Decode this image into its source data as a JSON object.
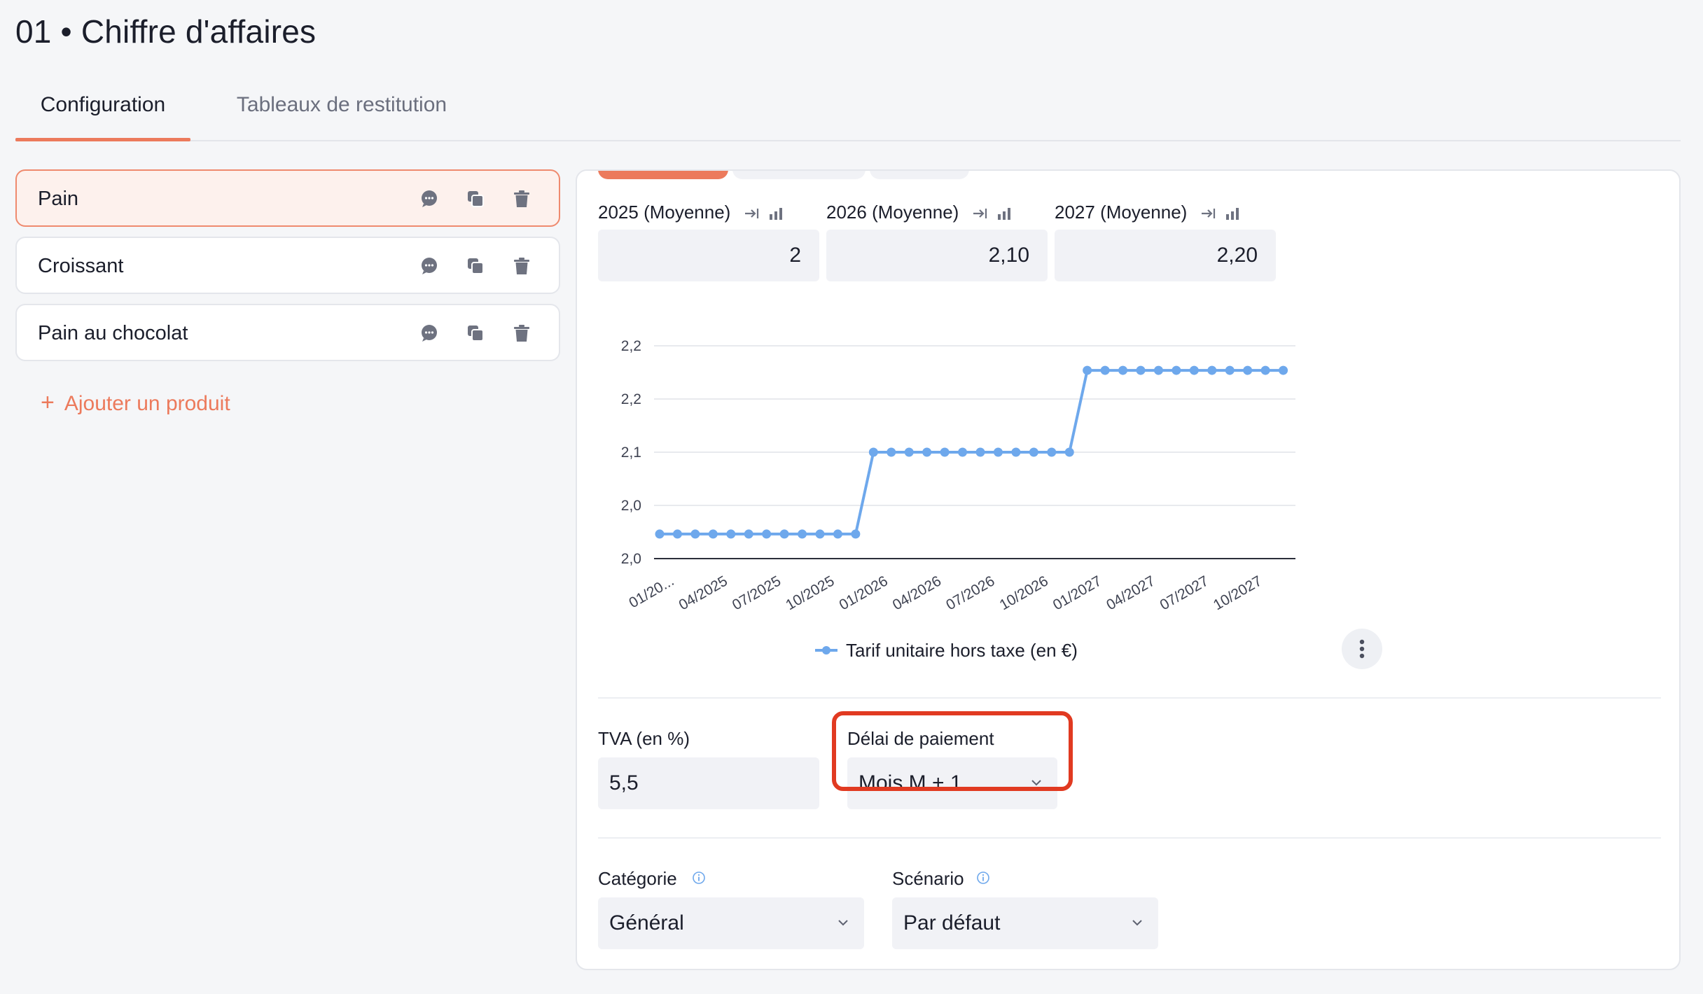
{
  "header": {
    "title": "01 • Chiffre d'affaires"
  },
  "tabs": [
    {
      "label": "Configuration",
      "active": true
    },
    {
      "label": "Tableaux de restitution",
      "active": false
    }
  ],
  "products": [
    {
      "name": "Pain",
      "selected": true
    },
    {
      "name": "Croissant",
      "selected": false
    },
    {
      "name": "Pain au chocolat",
      "selected": false
    }
  ],
  "add_product_label": "Ajouter un produit",
  "years": [
    {
      "label": "2025 (Moyenne)",
      "value": "2"
    },
    {
      "label": "2026 (Moyenne)",
      "value": "2,10"
    },
    {
      "label": "2027 (Moyenne)",
      "value": "2,20"
    }
  ],
  "chart_data": {
    "type": "line",
    "x": [
      "01/2025",
      "02/2025",
      "03/2025",
      "04/2025",
      "05/2025",
      "06/2025",
      "07/2025",
      "08/2025",
      "09/2025",
      "10/2025",
      "11/2025",
      "12/2025",
      "01/2026",
      "02/2026",
      "03/2026",
      "04/2026",
      "05/2026",
      "06/2026",
      "07/2026",
      "08/2026",
      "09/2026",
      "10/2026",
      "11/2026",
      "12/2026",
      "01/2027",
      "02/2027",
      "03/2027",
      "04/2027",
      "05/2027",
      "06/2027",
      "07/2027",
      "08/2027",
      "09/2027",
      "10/2027",
      "11/2027",
      "12/2027"
    ],
    "x_tick_labels": [
      "01/20...",
      "04/2025",
      "07/2025",
      "10/2025",
      "01/2026",
      "04/2026",
      "07/2026",
      "10/2026",
      "01/2027",
      "04/2027",
      "07/2027",
      "10/2027"
    ],
    "y_tick_labels": [
      "2,2",
      "2,2",
      "2,1",
      "2,0",
      "2,0"
    ],
    "ylim": [
      1.97,
      2.23
    ],
    "series": [
      {
        "name": "Tarif unitaire hors taxe (en €)",
        "color": "#6ea8ec",
        "values": [
          2.0,
          2.0,
          2.0,
          2.0,
          2.0,
          2.0,
          2.0,
          2.0,
          2.0,
          2.0,
          2.0,
          2.0,
          2.1,
          2.1,
          2.1,
          2.1,
          2.1,
          2.1,
          2.1,
          2.1,
          2.1,
          2.1,
          2.1,
          2.1,
          2.2,
          2.2,
          2.2,
          2.2,
          2.2,
          2.2,
          2.2,
          2.2,
          2.2,
          2.2,
          2.2,
          2.2
        ]
      }
    ],
    "grid": true,
    "legend_position": "bottom"
  },
  "fields": {
    "tva_label": "TVA (en %)",
    "tva_value": "5,5",
    "delai_label": "Délai de paiement",
    "delai_value": "Mois M + 1",
    "categorie_label": "Catégorie",
    "categorie_value": "Général",
    "scenario_label": "Scénario",
    "scenario_value": "Par défaut"
  },
  "colors": {
    "accent": "#ec7a5c",
    "highlight": "#e13a21",
    "series": "#6ea8ec"
  }
}
